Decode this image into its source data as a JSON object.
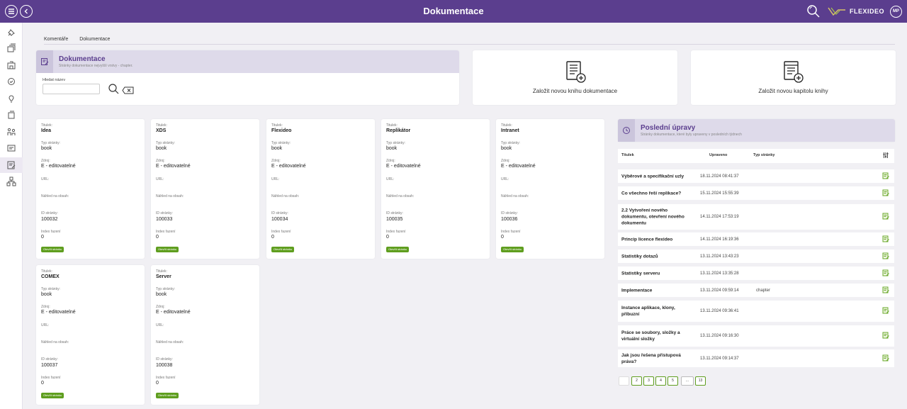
{
  "header": {
    "title": "Dokumentace",
    "brand": "FLEXIDEO",
    "user_initials": "MP"
  },
  "sidebar": {
    "icons": [
      "pin-icon",
      "layers-icon",
      "building-icon",
      "badge-icon",
      "lightbulb-icon",
      "documents-icon",
      "people-icon",
      "card-icon",
      "doc-edit-icon",
      "network-icon"
    ]
  },
  "tabs": [
    "Komentáře",
    "Dokumentace"
  ],
  "panel": {
    "title": "Dokumentace",
    "subtitle": "Stránky dokumentace nejvyšší vrstvy - chapter.",
    "search_label": "Hledat název",
    "search_value": ""
  },
  "actions": {
    "new_book": "Založit novou knihu dokumentace",
    "new_chapter": "Založit novou kapitolu knihy"
  },
  "labels": {
    "title": "Titulek:",
    "type": "Typ stránky:",
    "source": "Zdroj:",
    "url": "URL:",
    "preview": "Náhled na obsah:",
    "id": "ID stránky:",
    "index": "Index řazení",
    "open": "Otevřít stránku"
  },
  "pages": [
    {
      "title": "Idea",
      "type": "book",
      "source": "E - editovatelné",
      "id": "100032",
      "index": "0"
    },
    {
      "title": "XDS",
      "type": "book",
      "source": "E - editovatelné",
      "id": "100033",
      "index": "0"
    },
    {
      "title": "Flexideo",
      "type": "book",
      "source": "E - editovatelné",
      "id": "100034",
      "index": "0"
    },
    {
      "title": "Replikátor",
      "type": "book",
      "source": "E - editovatelné",
      "id": "100035",
      "index": "0"
    },
    {
      "title": "Intranet",
      "type": "book",
      "source": "E - editovatelné",
      "id": "100036",
      "index": "0"
    },
    {
      "title": "COMEX",
      "type": "book",
      "source": "E - editovatelné",
      "id": "100037",
      "index": "0"
    },
    {
      "title": "Server",
      "type": "book",
      "source": "E - editovatelné",
      "id": "100038",
      "index": "0"
    }
  ],
  "recent": {
    "title": "Poslední úpravy",
    "subtitle": "Stránky dokumentace, které byly upraveny v posledních týdnech",
    "columns": [
      "Titulek",
      "Upraveno",
      "Typ stránky"
    ],
    "rows": [
      {
        "title": "Výběrové a specifikační uzly",
        "date": "18.11.2024 08:41:37",
        "type": ""
      },
      {
        "title": "Co všechno řeší replikace?",
        "date": "15.11.2024 15:55:39",
        "type": ""
      },
      {
        "title": "2.2 Vytvoření nového dokumentu, otevření nového dokumentu",
        "date": "14.11.2024 17:53:19",
        "type": ""
      },
      {
        "title": "Princip licence flexideo",
        "date": "14.11.2024 16:19:36",
        "type": ""
      },
      {
        "title": "Statistiky dotazů",
        "date": "13.11.2024 13:43:23",
        "type": ""
      },
      {
        "title": "Statistiky serveru",
        "date": "13.11.2024 13:35:28",
        "type": ""
      },
      {
        "title": "Implementace",
        "date": "13.11.2024 09:59:14",
        "type": "chapter"
      },
      {
        "title": "Instance aplikace, klony, příbuzní",
        "date": "13.11.2024 09:36:41",
        "type": ""
      },
      {
        "title": "Práce se soubory, složky a virtuální složky",
        "date": "13.11.2024 09:16:30",
        "type": ""
      },
      {
        "title": "Jak jsou řešena přístupová práva?",
        "date": "13.11.2024 09:14:37",
        "type": ""
      }
    ],
    "pagination": [
      "1",
      "2",
      "3",
      "4",
      "5",
      "...",
      "13"
    ]
  },
  "colors": {
    "accent": "#5b3e8e",
    "green": "#5f9e1f"
  }
}
